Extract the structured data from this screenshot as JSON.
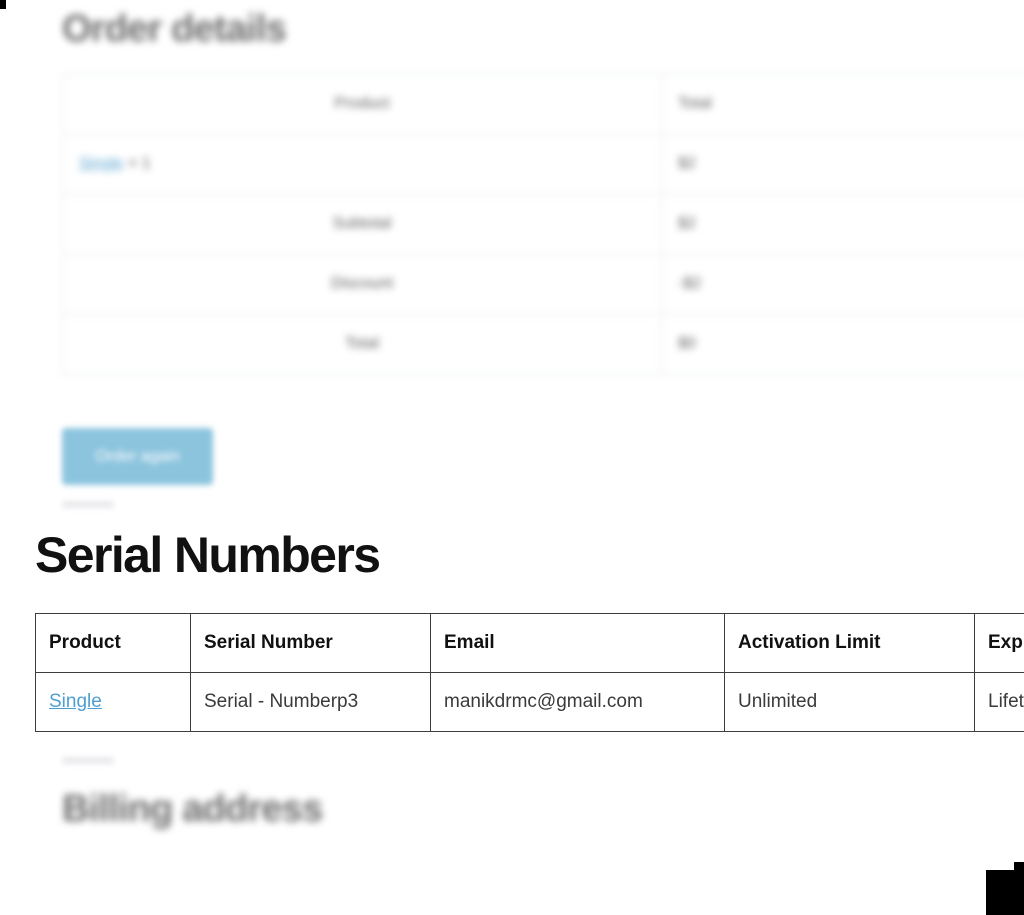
{
  "order_details": {
    "heading": "Order details",
    "table": {
      "headers": [
        "Product",
        "Total"
      ],
      "product_row": {
        "product_link": "Single",
        "quantity": "× 1",
        "total": "$2"
      },
      "summary_rows": [
        {
          "label": "Subtotal",
          "amount": "$2"
        },
        {
          "label": "Discount",
          "amount": "-$2"
        },
        {
          "label": "Total",
          "amount": "$0"
        }
      ]
    },
    "order_again_label": "Order again"
  },
  "serial_numbers": {
    "heading": "Serial Numbers",
    "columns": [
      "Product",
      "Serial Number",
      "Email",
      "Activation Limit",
      "Expires"
    ],
    "rows": [
      {
        "product": "Single",
        "serial_number": "Serial - Numberp3",
        "email": "manikdrmc@gmail.com",
        "activation_limit": "Unlimited",
        "expires": "Lifetime"
      }
    ]
  },
  "billing": {
    "heading": "Billing address"
  },
  "colors": {
    "link_blue": "#4e9fd1",
    "button_blue": "#8cc4de",
    "heading_black": "#111111",
    "blurred_gray": "#6f6f6f",
    "table_border": "#3d3d3d",
    "soft_border": "#e4e6e8"
  }
}
